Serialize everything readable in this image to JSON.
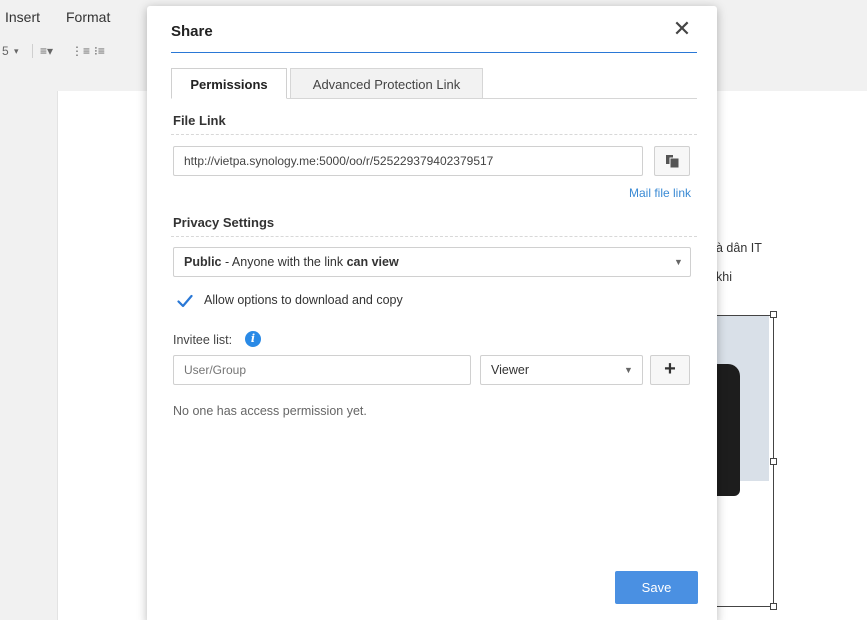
{
  "menubar": {
    "items": [
      "Insert",
      "Format"
    ]
  },
  "toolbar": {
    "glyphs": [
      "5",
      "▾",
      "≡▾",
      "⋮≡",
      "⁝≡"
    ]
  },
  "document": {
    "snippets": [
      "à dân IT",
      "khi"
    ]
  },
  "dialog": {
    "title": "Share",
    "close_icon": "close-icon",
    "tabs": [
      {
        "label": "Permissions",
        "active": true
      },
      {
        "label": "Advanced Protection Link",
        "active": false
      }
    ],
    "file_link": {
      "label": "File Link",
      "value": "http://vietpa.synology.me:5000/oo/r/525229379402379517",
      "copy_icon": "copy-icon",
      "mail_link": "Mail file link"
    },
    "privacy": {
      "label": "Privacy Settings",
      "selected_strong": "Public",
      "selected_middle": " - Anyone with the link ",
      "selected_end": "can view"
    },
    "allow_download": {
      "checked": true,
      "label": "Allow options to download and copy"
    },
    "invitee": {
      "label": "Invitee list:",
      "info_icon": "info-icon",
      "input_placeholder": "User/Group",
      "role_value": "Viewer",
      "empty_message": "No one has access permission yet."
    },
    "save_label": "Save"
  },
  "colors": {
    "accent": "#2a78d6",
    "save_button": "#4a90e2",
    "link": "#3a8ad4",
    "check": "#2a78d6"
  }
}
